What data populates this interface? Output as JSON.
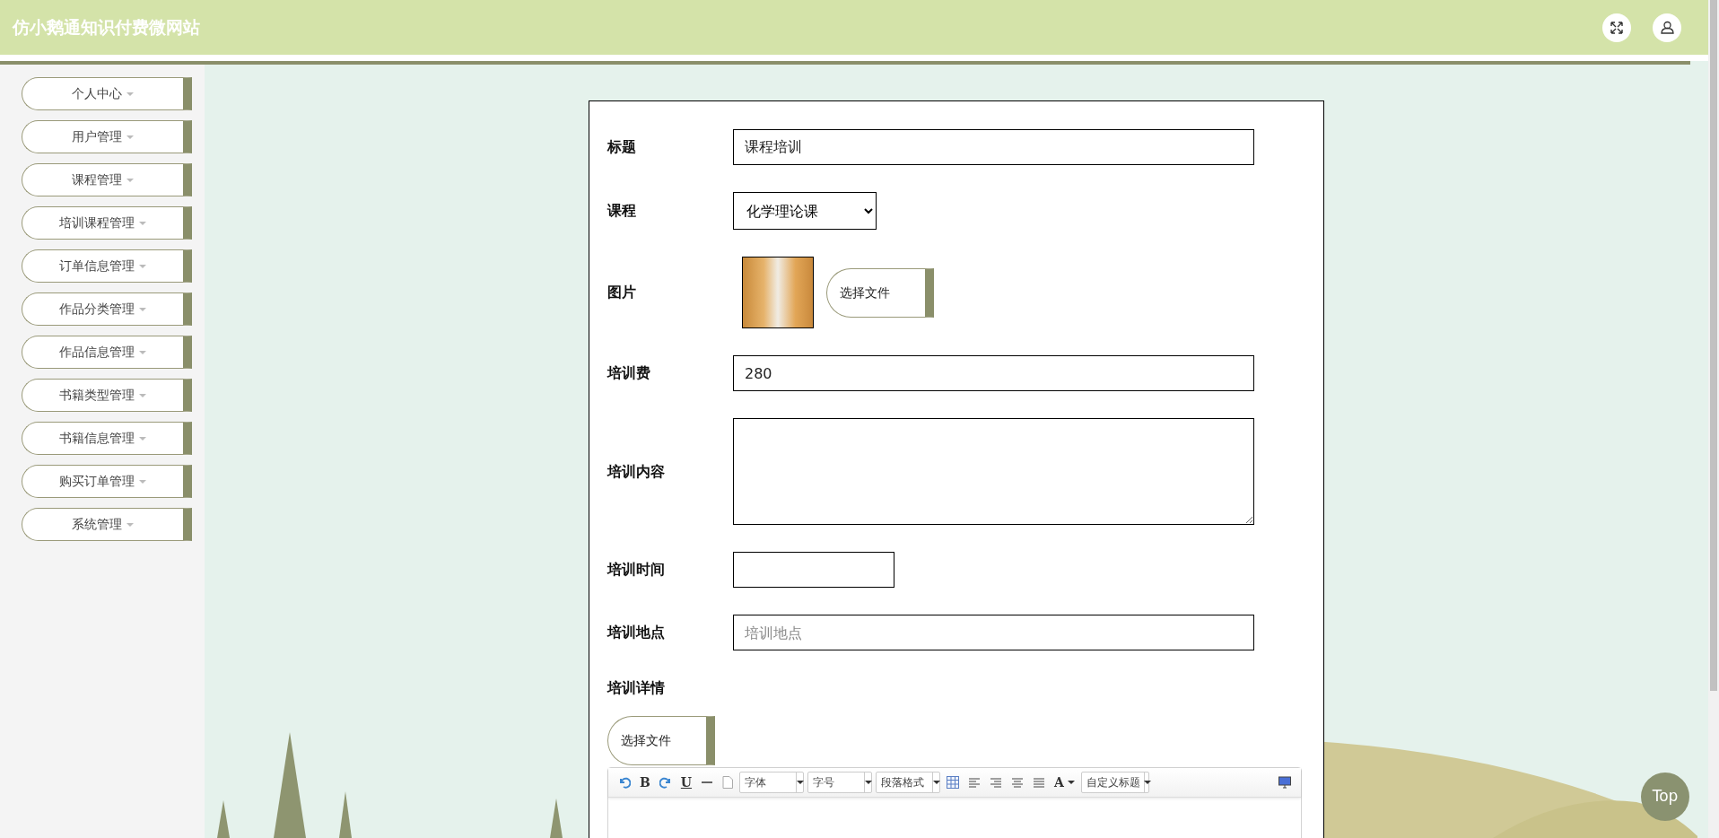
{
  "header": {
    "title": "仿小鹅通知识付费微网站"
  },
  "sidebar": {
    "items": [
      {
        "label": "个人中心"
      },
      {
        "label": "用户管理"
      },
      {
        "label": "课程管理"
      },
      {
        "label": "培训课程管理"
      },
      {
        "label": "订单信息管理"
      },
      {
        "label": "作品分类管理"
      },
      {
        "label": "作品信息管理"
      },
      {
        "label": "书籍类型管理"
      },
      {
        "label": "书籍信息管理"
      },
      {
        "label": "购买订单管理"
      },
      {
        "label": "系统管理"
      }
    ]
  },
  "form": {
    "fields": [
      {
        "kind": "text",
        "label": "标题",
        "value": "课程培训"
      },
      {
        "kind": "select",
        "label": "课程",
        "value": "化学理论课"
      },
      {
        "kind": "image",
        "label": "图片",
        "button": "选择文件"
      },
      {
        "kind": "text",
        "label": "培训费",
        "value": "280"
      },
      {
        "kind": "textarea",
        "label": "培训内容"
      },
      {
        "kind": "date",
        "label": "培训时间"
      },
      {
        "kind": "text",
        "label": "培训地点",
        "placeholder": "培训地点"
      },
      {
        "kind": "editor",
        "label": "培训详情",
        "button": "选择文件",
        "letters": [
          "B",
          "U",
          "A"
        ],
        "dropdowns": [
          "字体",
          "字号",
          "段落格式",
          "自定义标题"
        ]
      }
    ]
  },
  "back_to_top": "Top"
}
